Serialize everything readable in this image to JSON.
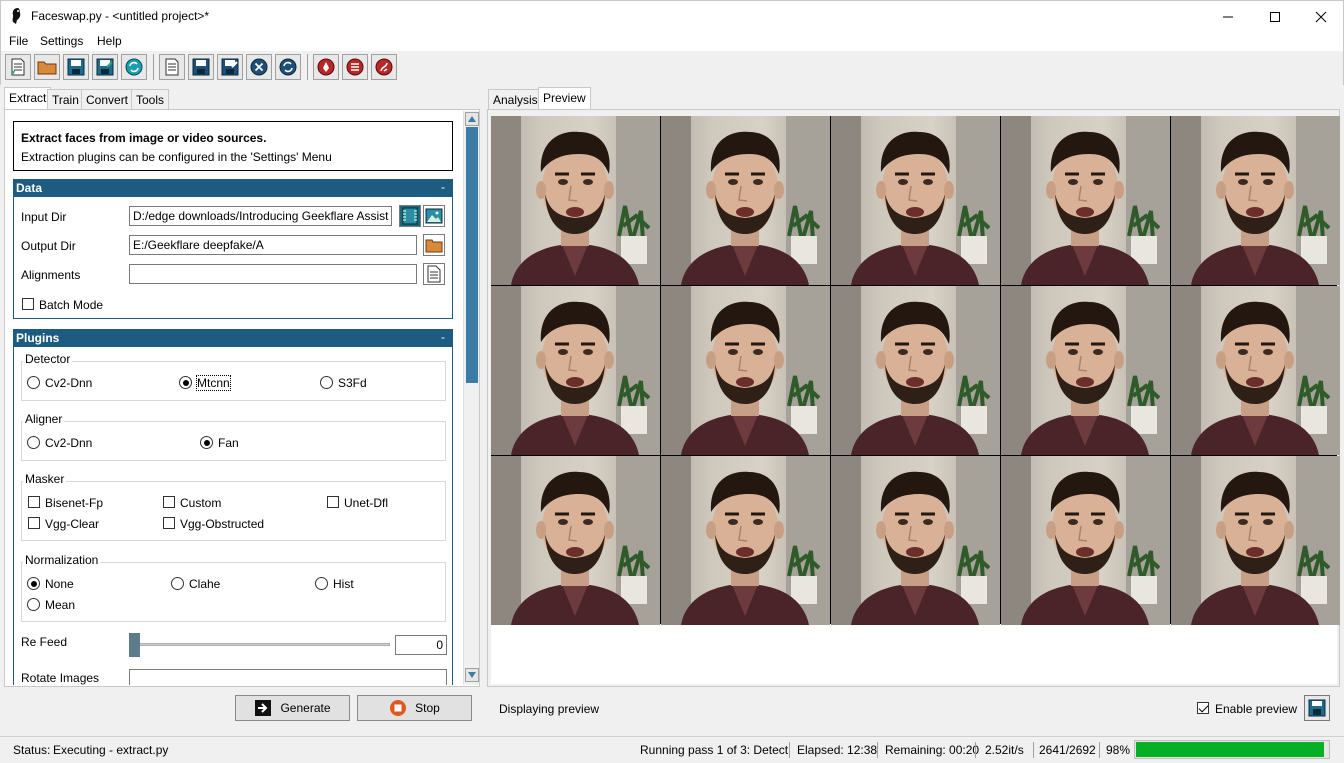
{
  "window": {
    "title": "Faceswap.py - <untitled project>*"
  },
  "menu": [
    "File",
    "Settings",
    "Help"
  ],
  "toolbar": {
    "buttons": [
      "new-project-icon",
      "open-project-icon",
      "save-project-icon",
      "save-project-as-icon",
      "reload-project-icon",
      "new-task-icon",
      "save-task-icon",
      "save-task-as-icon",
      "clear-task-icon",
      "reload-task-icon",
      "patreon-icon",
      "docs-icon",
      "github-icon"
    ]
  },
  "left_tabs": [
    "Extract",
    "Train",
    "Convert",
    "Tools"
  ],
  "info": {
    "heading": "Extract faces from image or video sources.",
    "sub": "Extraction plugins can be configured in the 'Settings' Menu"
  },
  "data_section": {
    "title": "Data",
    "collapse": "-",
    "input_dir_label": "Input Dir",
    "input_dir_value": "D:/edge downloads/Introducing Geekflare Assist (",
    "output_dir_label": "Output Dir",
    "output_dir_value": "E:/Geekflare deepfake/A",
    "alignments_label": "Alignments",
    "alignments_value": "",
    "batch_mode_label": "Batch Mode",
    "batch_mode_checked": false
  },
  "plugins_section": {
    "title": "Plugins",
    "collapse": "-",
    "detector": {
      "title": "Detector",
      "options": [
        "Cv2-Dnn",
        "Mtcnn",
        "S3Fd"
      ],
      "selected": "Mtcnn"
    },
    "aligner": {
      "title": "Aligner",
      "options": [
        "Cv2-Dnn",
        "Fan"
      ],
      "selected": "Fan"
    },
    "masker": {
      "title": "Masker",
      "options": [
        "Bisenet-Fp",
        "Custom",
        "Unet-Dfl",
        "Vgg-Clear",
        "Vgg-Obstructed"
      ]
    },
    "normalization": {
      "title": "Normalization",
      "options": [
        "None",
        "Clahe",
        "Hist",
        "Mean"
      ],
      "selected": "None"
    },
    "re_feed_label": "Re Feed",
    "re_feed_value": "0",
    "rotate_label": "Rotate Images"
  },
  "actions": {
    "generate": "Generate",
    "stop": "Stop"
  },
  "right_tabs": [
    "Analysis",
    "Preview"
  ],
  "preview": {
    "footer_text": "Displaying preview",
    "enable_label": "Enable preview",
    "enable_checked": true
  },
  "status": {
    "label": "Status:",
    "value": "Executing - extract.py",
    "pass": "Running pass 1 of 3: Detect",
    "elapsed": "Elapsed: 12:38",
    "remaining": "Remaining: 00:20",
    "rate": "2.52it/s",
    "count": "2641/2692",
    "percent": "98%",
    "progress_fraction": 0.98
  },
  "colors": {
    "section_header": "#1d5b80",
    "progress": "#06b025",
    "scroll_thumb": "#3a7ca5"
  }
}
